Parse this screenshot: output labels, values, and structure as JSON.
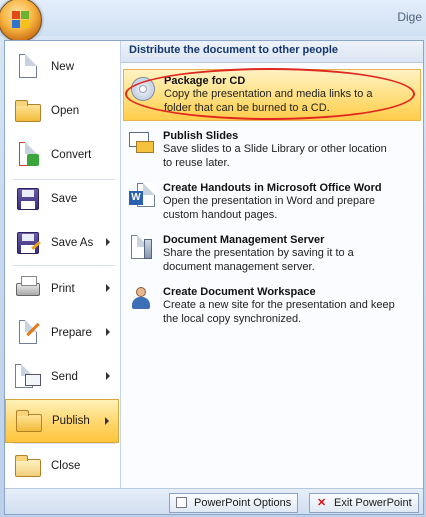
{
  "window": {
    "title": "Dige"
  },
  "left_menu": [
    {
      "label": "New",
      "icon": "new-document-icon",
      "submenu": false
    },
    {
      "label": "Open",
      "icon": "open-folder-icon",
      "submenu": false
    },
    {
      "label": "Convert",
      "icon": "convert-icon",
      "submenu": false
    },
    {
      "label": "Save",
      "icon": "save-floppy-icon",
      "submenu": false
    },
    {
      "label": "Save As",
      "icon": "save-as-icon",
      "submenu": true
    },
    {
      "label": "Print",
      "icon": "printer-icon",
      "submenu": true
    },
    {
      "label": "Prepare",
      "icon": "prepare-icon",
      "submenu": true
    },
    {
      "label": "Send",
      "icon": "send-icon",
      "submenu": true
    },
    {
      "label": "Publish",
      "icon": "publish-icon",
      "submenu": true,
      "active": true
    },
    {
      "label": "Close",
      "icon": "close-folder-icon",
      "submenu": false
    }
  ],
  "publish_panel": {
    "header": "Distribute the document to other people",
    "items": [
      {
        "title": "Package for CD",
        "desc": "Copy the presentation and media links to a folder that can be burned to a CD.",
        "icon": "cd-icon",
        "highlighted": true
      },
      {
        "title": "Publish Slides",
        "desc": "Save slides to a Slide Library or other location to reuse later.",
        "icon": "publish-slides-icon"
      },
      {
        "title": "Create Handouts in Microsoft Office Word",
        "desc": "Open the presentation in Word and prepare custom handout pages.",
        "icon": "word-handouts-icon"
      },
      {
        "title": "Document Management Server",
        "desc": "Share the presentation by saving it to a document management server.",
        "icon": "document-server-icon"
      },
      {
        "title": "Create Document Workspace",
        "desc": "Create a new site for the presentation and keep the local copy synchronized.",
        "icon": "document-workspace-icon"
      }
    ]
  },
  "bottom_bar": {
    "options_label": "PowerPoint Options",
    "exit_label": "Exit PowerPoint"
  },
  "colors": {
    "active_item": "#ffd66b",
    "highlight_ring": "#e0281f",
    "header_text": "#15386b"
  }
}
